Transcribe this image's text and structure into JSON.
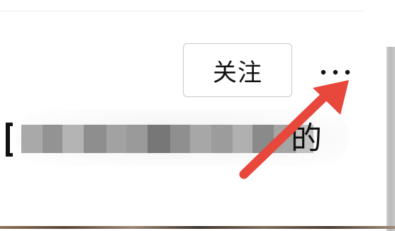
{
  "header": {
    "follow_label": "关注"
  },
  "headline": {
    "trailing_char": "的"
  },
  "icons": {
    "more": "more-horizontal-icon",
    "arrow": "annotation-arrow-icon"
  },
  "colors": {
    "arrow_red": "#e8473b",
    "mosaic": [
      "#a9a9a9",
      "#939393",
      "#b4b4b4",
      "#8e8e8e",
      "#a2a2a2",
      "#9a9a9a",
      "#777777",
      "#8f8f8f",
      "#a7a7a7",
      "#9c9c9c",
      "#b0b0b0",
      "#8a8a8a",
      "#a5a5a5",
      "#c2c2c2"
    ]
  }
}
